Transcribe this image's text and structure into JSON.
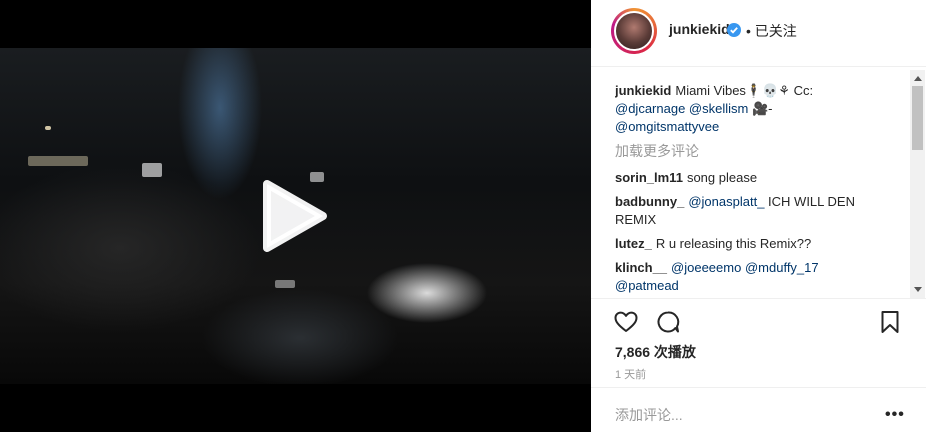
{
  "post": {
    "username": "junkiekid",
    "follow_status": "• 已关注",
    "caption_user": "junkiekid",
    "caption_text": "Miami Vibes",
    "caption_emojis": "🕴💀⚘",
    "caption_cc": "Cc:",
    "caption_mentions": [
      "@djcarnage",
      "@skellism"
    ],
    "caption_camera": "🎥",
    "caption_dash": "-",
    "caption_mention_last": "@omgitsmattyvee",
    "load_more": "加载更多评论",
    "comments": [
      {
        "user": "sorin_lm11",
        "text": "song please"
      },
      {
        "user": "badbunny_",
        "mention": "@jonasplatt_",
        "text": "ICH WILL DEN REMIX"
      },
      {
        "user": "lutez_",
        "text": "R u releasing this Remix??"
      },
      {
        "user": "klinch__",
        "mentions": [
          "@joeeeemo",
          "@mduffy_17",
          "@patmead"
        ]
      }
    ],
    "views": "7,866 次播放",
    "time_ago": "1 天前",
    "add_comment_placeholder": "添加评论...",
    "more_options": "•••"
  }
}
